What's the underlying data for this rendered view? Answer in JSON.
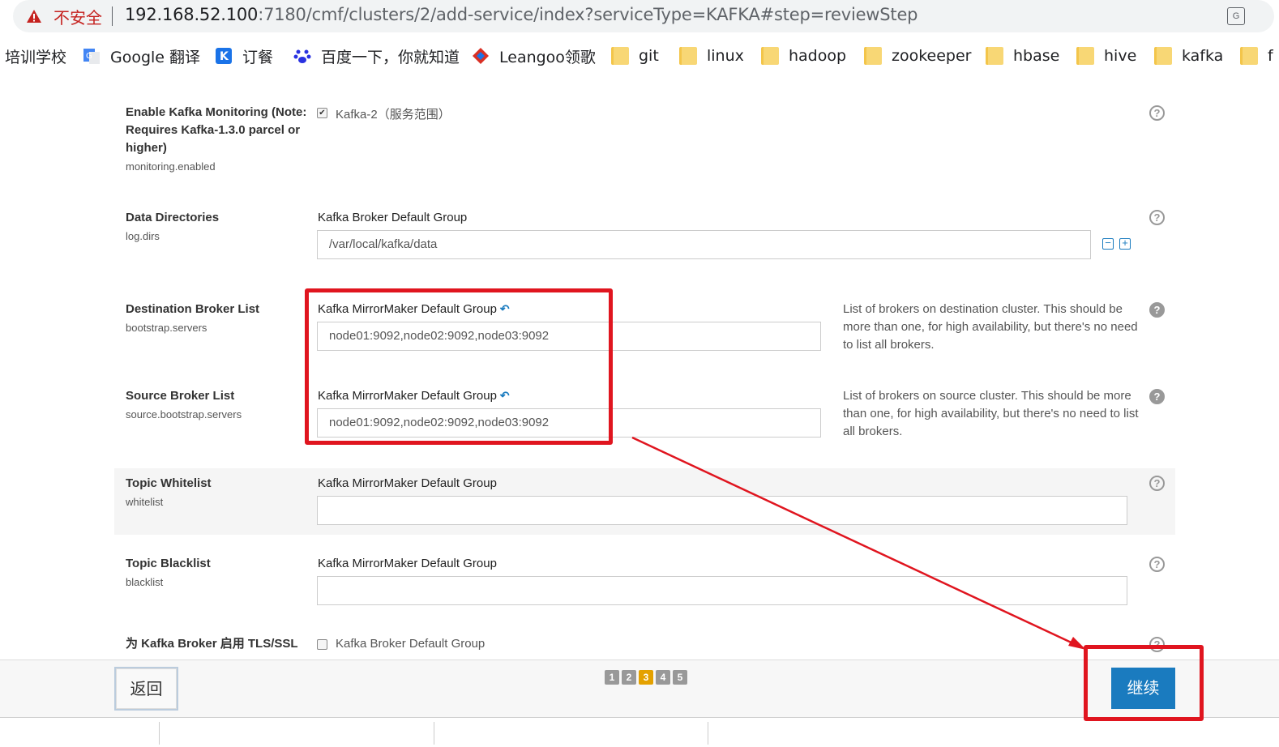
{
  "browser": {
    "insecure_label": "不安全",
    "url_host": "192.168.52.100",
    "url_rest": ":7180/cmf/clusters/2/add-service/index?serviceType=KAFKA#step=reviewStep",
    "translate_icon": "translate-icon"
  },
  "bookmarks": [
    {
      "label": "培训学校",
      "icon": ""
    },
    {
      "label": "Google 翻译",
      "icon": "google-translate-icon"
    },
    {
      "label": "订餐",
      "icon": "k-icon"
    },
    {
      "label": "百度一下，你就知道",
      "icon": "baidu-paw-icon"
    },
    {
      "label": "Leangoo领歌",
      "icon": "leangoo-icon"
    },
    {
      "label": "git",
      "icon": "folder-icon"
    },
    {
      "label": "linux",
      "icon": "folder-icon"
    },
    {
      "label": "hadoop",
      "icon": "folder-icon"
    },
    {
      "label": "zookeeper",
      "icon": "folder-icon"
    },
    {
      "label": "hbase",
      "icon": "folder-icon"
    },
    {
      "label": "hive",
      "icon": "folder-icon"
    },
    {
      "label": "kafka",
      "icon": "folder-icon"
    },
    {
      "label": "f",
      "icon": "folder-icon"
    }
  ],
  "config": {
    "monitoring": {
      "label_line1": "Enable Kafka Monitoring (Note:",
      "label_line2": "Requires Kafka-1.3.0 parcel or",
      "label_line3": "higher)",
      "key": "monitoring.enabled",
      "checkbox_label": "Kafka-2（服务范围）",
      "checked": true
    },
    "data_dirs": {
      "label": "Data Directories",
      "key": "log.dirs",
      "group": "Kafka Broker Default Group",
      "value": "/var/local/kafka/data"
    },
    "dest_brokers": {
      "label": "Destination Broker List",
      "key": "bootstrap.servers",
      "group": "Kafka MirrorMaker Default Group",
      "value": "node01:9092,node02:9092,node03:9092",
      "desc_line1": "List of brokers on destination cluster. This should be",
      "desc_line2": "more than one, for high availability, but there's no need",
      "desc_line3": "to list all brokers."
    },
    "source_brokers": {
      "label": "Source Broker List",
      "key": "source.bootstrap.servers",
      "group": "Kafka MirrorMaker Default Group",
      "value": "node01:9092,node02:9092,node03:9092",
      "desc_line1": "List of brokers on source cluster. This should be more",
      "desc_line2": "than one, for high availability, but there's no need to list",
      "desc_line3": "all brokers."
    },
    "whitelist": {
      "label": "Topic Whitelist",
      "key": "whitelist",
      "group": "Kafka MirrorMaker Default Group",
      "value": ""
    },
    "blacklist": {
      "label": "Topic Blacklist",
      "key": "blacklist",
      "group": "Kafka MirrorMaker Default Group",
      "value": ""
    },
    "tls": {
      "label": "为 Kafka Broker 启用 TLS/SSL",
      "checkbox_label": "Kafka Broker Default Group",
      "checked": false
    }
  },
  "footer": {
    "back_label": "返回",
    "continue_label": "继续",
    "steps": [
      "1",
      "2",
      "3",
      "4",
      "5"
    ],
    "active_step": "3"
  },
  "help_glyph": "?",
  "undo_glyph": "↶",
  "minus_glyph": "−",
  "plus_glyph": "+",
  "check_glyph": "✔",
  "accent_color": "#1a7bbf",
  "highlight_color": "#e0151f"
}
